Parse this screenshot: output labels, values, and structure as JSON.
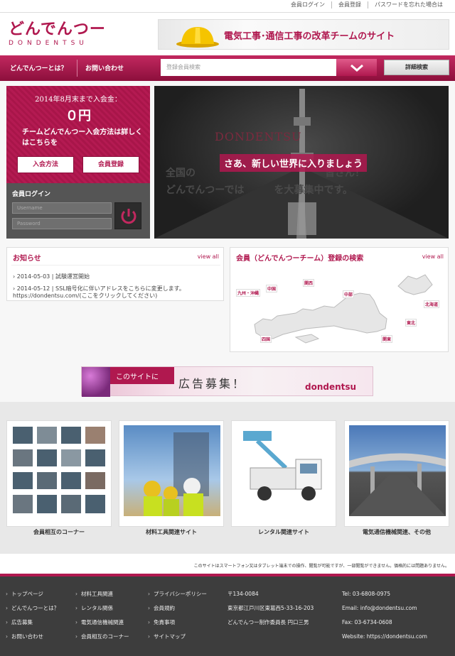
{
  "top_links": [
    "会員ログイン",
    "会員登録",
    "パスワードを忘れた場合は"
  ],
  "logo": {
    "main": "どんでんつー",
    "sub": "DONDENTSU"
  },
  "banner": {
    "text": "電気工事･通信工事の改革チームのサイト"
  },
  "nav": {
    "about": "どんでんつーとは？",
    "contact": "お問い合わせ",
    "search_placeholder": "登録会員検索",
    "detail_search": "詳細検索"
  },
  "promo": {
    "line1": "2014年8月末まで入会金：",
    "price": "０円",
    "desc": "チームどんでんつー入会方法は詳しくはこちらを",
    "join_button": "入会方法",
    "register_button": "会員登録"
  },
  "login": {
    "title": "会員ログイン",
    "username_placeholder": "Username",
    "password_placeholder": "Password"
  },
  "hero": {
    "watermark": "DONDENTSU",
    "catch": "さあ、新しい世界に入りましょう",
    "sub1": "全国の　　　　　　　　　　　　　皆さん！",
    "sub2": "どんでんつーでは　　　を大募集中です。"
  },
  "news": {
    "title": "お知らせ",
    "view_all": "view all",
    "items": [
      "2014-05-03 | 試験運営開始",
      "2014-05-12 | SSL暗号化に伴いアドレスをこちらに変更します。",
      "https://dondentsu.com/(ここをクリックしてください)"
    ]
  },
  "member_search": {
    "title": "会員（どんでんつーチーム）登録の検索",
    "view_all": "view all",
    "regions": [
      "九州・沖縄",
      "中国",
      "関西",
      "中部",
      "北海道",
      "東北",
      "関東",
      "四国"
    ]
  },
  "ad": {
    "t1": "このサイトに",
    "t2": "広告募集！",
    "t3": "dondentsu"
  },
  "categories": [
    "会員相互のコーナー",
    "材料工具関連サイト",
    "レンタル関連サイト",
    "電気通信機械関連、その他"
  ],
  "notice": "このサイトはスマートフォン又はタブレット端末での操作、閲覧が可能ですが、一部閲覧ができません。価格的には問題ありません。",
  "footer": {
    "col1": [
      "トップページ",
      "どんでんつーとは？",
      "広告募集",
      "お問い合わせ"
    ],
    "col2": [
      "材料工具関連",
      "レンタル関係",
      "電気通信機械関連",
      "会員相互のコーナー"
    ],
    "col3": [
      "プライバシーポリシー",
      "会員規約",
      "免責事項",
      "サイトマップ"
    ],
    "address": [
      "〒134-0084",
      "東京都江戸川区東葛西5-33-16-203",
      "どんでんつー制作委員長 円口三男"
    ],
    "contact": [
      "Tel: 03-6808-0975",
      "Email: info@dondentsu.com",
      "Fax: 03-6734-0608",
      "Website: https://dondentsu.com"
    ]
  },
  "colors": {
    "brand": "#b0184f",
    "footer_bg": "#3d3d3d"
  }
}
